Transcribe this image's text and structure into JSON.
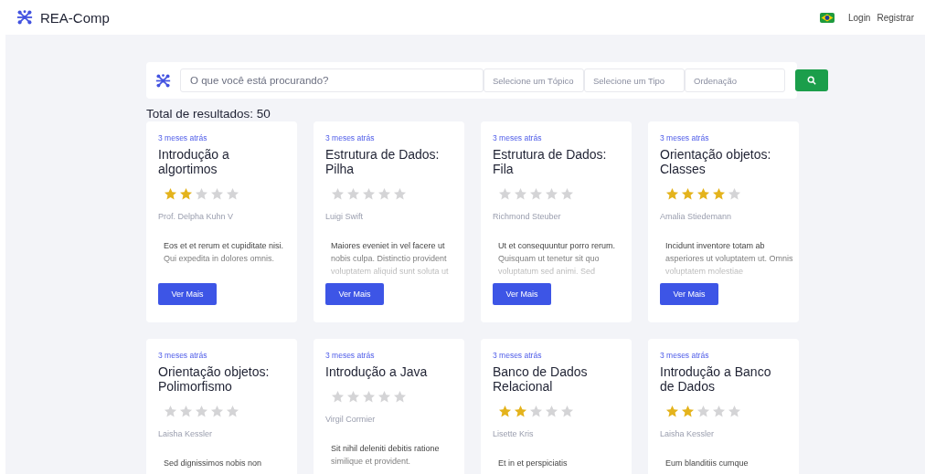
{
  "header": {
    "brand": "REA-Comp",
    "links": [
      {
        "label": "Login"
      },
      {
        "label": "Registrar"
      }
    ]
  },
  "search": {
    "placeholder": "O que você está procurando?",
    "filters": [
      {
        "placeholder": "Selecione um Tópico"
      },
      {
        "placeholder": "Selecione um Tipo"
      },
      {
        "placeholder": "Ordenação"
      }
    ]
  },
  "total": "Total de resultados: 50",
  "cards": [
    {
      "time": "3 meses atrás",
      "title": "Introdução a algortimos",
      "stars": 2,
      "author": "Prof. Delpha Kuhn V",
      "description": "Eos et et rerum et cupiditate nisi. Qui expedita in dolores omnis.",
      "button": "Ver Mais"
    },
    {
      "time": "3 meses atrás",
      "title": "Estrutura de Dados: Pilha",
      "stars": 0,
      "author": "Luigi Swift",
      "description": "Maiores eveniet in vel facere ut nobis culpa. Distinctio provident voluptatem aliquid sunt soluta ut",
      "button": "Ver Mais"
    },
    {
      "time": "3 meses atrás",
      "title": "Estrutura de Dados: Fila",
      "stars": 0,
      "author": "Richmond Steuber",
      "description": "Ut et consequuntur porro rerum. Quisquam ut tenetur sit quo voluptatum sed animi. Sed",
      "button": "Ver Mais"
    },
    {
      "time": "3 meses atrás",
      "title": "Orientação objetos: Classes",
      "stars": 4,
      "author": "Amalia Stiedemann",
      "description": "Incidunt inventore totam ab asperiores ut voluptatem ut. Omnis voluptatem molestiae",
      "button": "Ver Mais"
    },
    {
      "time": "3 meses atrás",
      "title": "Orientação objetos: Polimorfismo",
      "stars": 0,
      "author": "Laisha Kessler",
      "description": "Sed dignissimos nobis non"
    },
    {
      "time": "3 meses atrás",
      "title": "Introdução a Java",
      "stars": 0,
      "author": "Virgil Cormier",
      "description": "Sit nihil deleniti debitis ratione similique et provident."
    },
    {
      "time": "3 meses atrás",
      "title": "Banco de Dados Relacional",
      "stars": 2,
      "author": "Lisette Kris",
      "description": "Et in et perspiciatis"
    },
    {
      "time": "3 meses atrás",
      "title": "Introdução a Banco de Dados",
      "stars": 2,
      "author": "Laisha Kessler",
      "description": "Eum blanditiis cumque"
    }
  ]
}
